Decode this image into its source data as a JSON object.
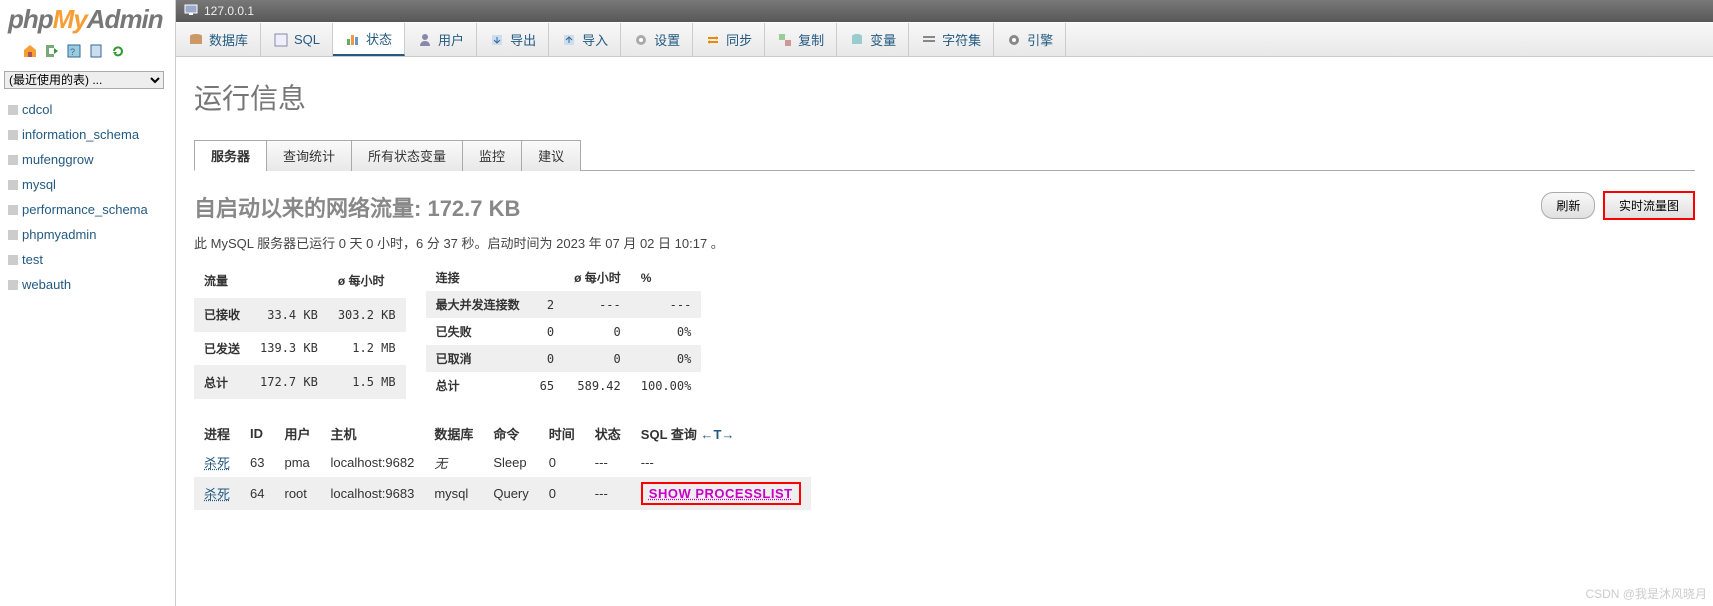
{
  "logo": {
    "php": "php",
    "my": "My",
    "admin": "Admin"
  },
  "breadcrumb": {
    "host": "127.0.0.1"
  },
  "recent_select": "(最近使用的表) ...",
  "databases": [
    "cdcol",
    "information_schema",
    "mufenggrow",
    "mysql",
    "performance_schema",
    "phpmyadmin",
    "test",
    "webauth"
  ],
  "topmenu": {
    "database": "数据库",
    "sql": "SQL",
    "status": "状态",
    "users": "用户",
    "export": "导出",
    "import": "导入",
    "settings": "设置",
    "sync": "同步",
    "replication": "复制",
    "variables": "变量",
    "charset": "字符集",
    "engine": "引擎"
  },
  "page_title": "运行信息",
  "sub_tabs": {
    "server": "服务器",
    "query_stats": "查询统计",
    "all_vars": "所有状态变量",
    "monitor": "监控",
    "advice": "建议"
  },
  "traffic": {
    "label_prefix": "自启动以来的网络流量: ",
    "value": "172.7 KB"
  },
  "runtime": "此 MySQL 服务器已运行 0 天 0 小时，6 分 37 秒。启动时间为 2023 年 07 月 02 日 10:17 。",
  "buttons": {
    "refresh": "刷新",
    "realtime": "实时流量图"
  },
  "traffic_table": {
    "headers": {
      "name": "流量",
      "per_hour": "ø 每小时"
    },
    "rows": [
      {
        "label": "已接收",
        "v1": "33.4 KB",
        "v2": "303.2 KB"
      },
      {
        "label": "已发送",
        "v1": "139.3 KB",
        "v2": "1.2 MB"
      },
      {
        "label": "总计",
        "v1": "172.7 KB",
        "v2": "1.5 MB"
      }
    ]
  },
  "conn_table": {
    "headers": {
      "name": "连接",
      "per_hour": "ø 每小时",
      "pct": "%"
    },
    "rows": [
      {
        "label": "最大并发连接数",
        "v1": "2",
        "v2": "---",
        "v3": "---"
      },
      {
        "label": "已失败",
        "v1": "0",
        "v2": "0",
        "v3": "0%"
      },
      {
        "label": "已取消",
        "v1": "0",
        "v2": "0",
        "v3": "0%"
      },
      {
        "label": "总计",
        "v1": "65",
        "v2": "589.42",
        "v3": "100.00%"
      }
    ]
  },
  "process_table": {
    "headers": {
      "kill": "进程",
      "id": "ID",
      "user": "用户",
      "host": "主机",
      "db": "数据库",
      "cmd": "命令",
      "time": "时间",
      "state": "状态",
      "query": "SQL 查询",
      "arrows": "←T→"
    },
    "kill_label": "杀死",
    "rows": [
      {
        "id": "63",
        "user": "pma",
        "host": "localhost:9682",
        "db": "无",
        "cmd": "Sleep",
        "time": "0",
        "state": "---",
        "query": "---"
      },
      {
        "id": "64",
        "user": "root",
        "host": "localhost:9683",
        "db": "mysql",
        "cmd": "Query",
        "time": "0",
        "state": "---",
        "query": "SHOW PROCESSLIST"
      }
    ]
  },
  "watermark": "CSDN @我是沐风晓月"
}
